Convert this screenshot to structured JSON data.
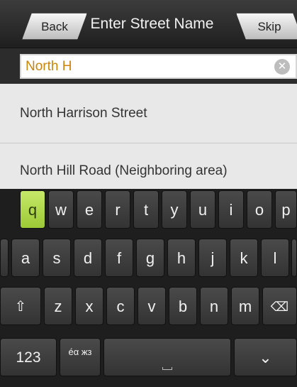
{
  "header": {
    "back_label": "Back",
    "title": "Enter Street Name",
    "skip_label": "Skip"
  },
  "search": {
    "value": "North H",
    "clear_icon": "✕"
  },
  "results": [
    {
      "label": "North Harrison Street"
    },
    {
      "label": "North Hill Road (Neighboring area)"
    }
  ],
  "keyboard": {
    "row1": [
      "q",
      "w",
      "e",
      "r",
      "t",
      "y",
      "u",
      "i",
      "o",
      "p"
    ],
    "row2": [
      "a",
      "s",
      "d",
      "f",
      "g",
      "h",
      "j",
      "k",
      "l"
    ],
    "row3": [
      "z",
      "x",
      "c",
      "v",
      "b",
      "n",
      "m"
    ],
    "shift_icon": "⇧",
    "backspace_icon": "⌫",
    "numbers_label": "123",
    "alt_chars_label": "éα жз",
    "hide_icon": "⌄",
    "highlighted_key": "q"
  },
  "colors": {
    "typed_text": "#c8860f",
    "active_key": "#9cc935"
  }
}
